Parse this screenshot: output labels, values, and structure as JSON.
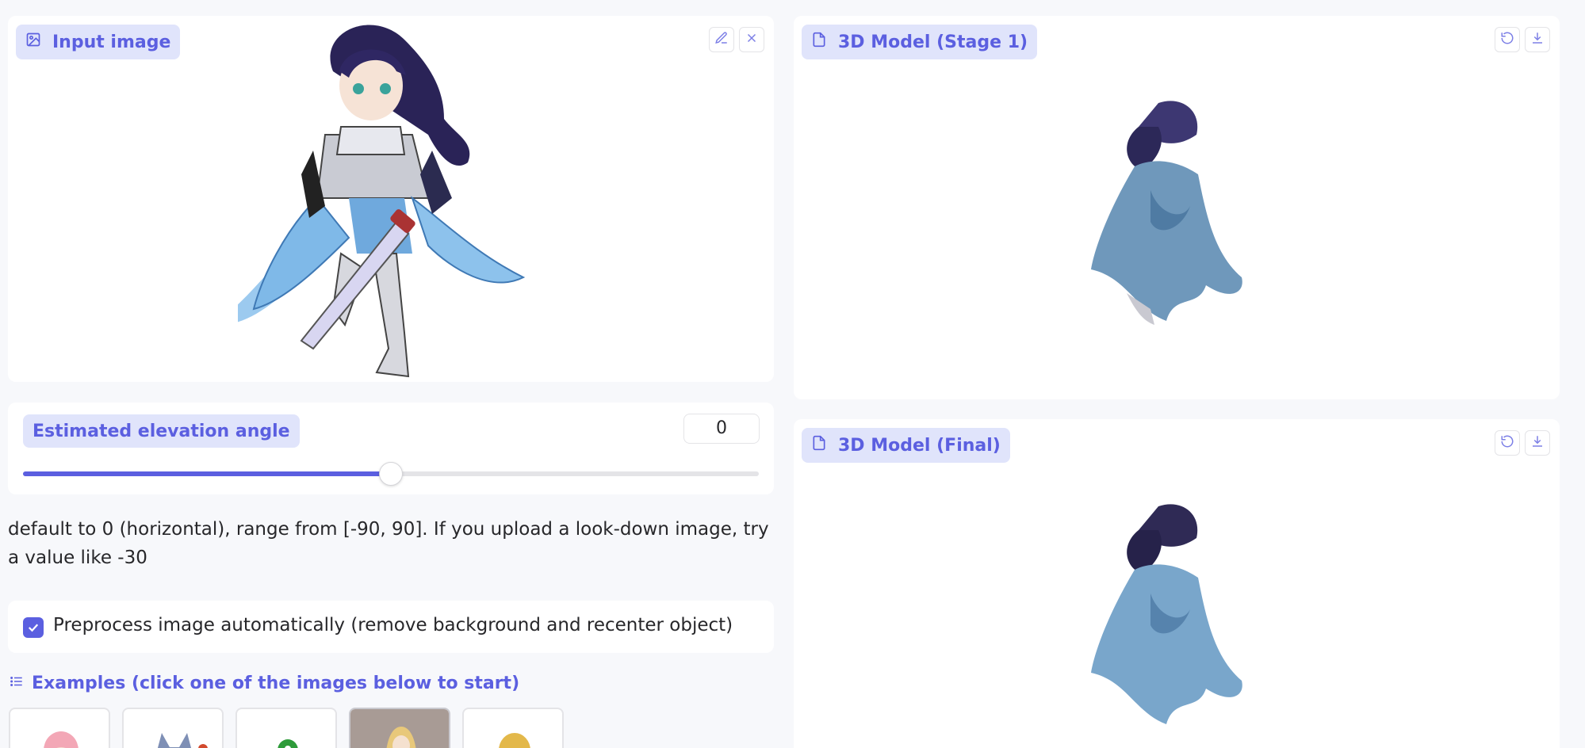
{
  "input_panel": {
    "label": "Input image",
    "icon": "image-icon",
    "edit_icon": "pencil-icon",
    "close_icon": "close-icon"
  },
  "stage1_panel": {
    "label": "3D Model (Stage 1)",
    "icon": "file-icon",
    "reset_icon": "undo-icon",
    "download_icon": "download-icon"
  },
  "final_panel": {
    "label": "3D Model (Final)",
    "icon": "file-icon",
    "reset_icon": "undo-icon",
    "download_icon": "download-icon"
  },
  "elevation": {
    "label": "Estimated elevation angle",
    "value": "0",
    "min": -90,
    "max": 90,
    "current": 0
  },
  "info_text": "default to 0 (horizontal), range from [-90, 90]. If you upload a look-down image, try a value like -30",
  "preprocess": {
    "label": "Preprocess image automatically (remove background and recenter object)",
    "checked": true
  },
  "examples": {
    "heading": "Examples (click one of the images below to start)",
    "icon": "list-icon"
  },
  "colors": {
    "accent": "#5b5fe0",
    "pill_bg": "#e0e4fb"
  }
}
